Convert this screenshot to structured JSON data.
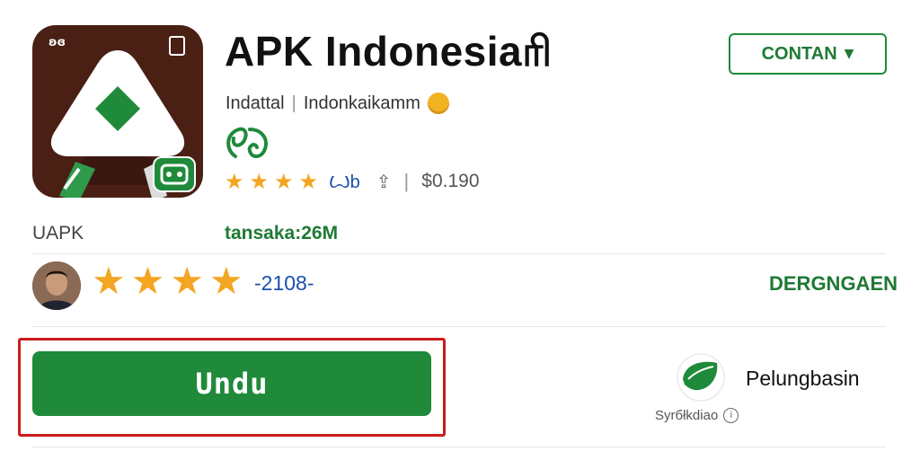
{
  "app": {
    "title": "APK Indonesiaரி",
    "developer": "Indattal",
    "category": "Indonkaikamm",
    "rating_label": "Ꙍb",
    "installs": "$0.190",
    "icon_marks": {
      "top_left": "ʚɞ"
    }
  },
  "header": {
    "content_button_label": "CONTAN"
  },
  "details": {
    "apk_label": "UAPK",
    "size_text": "tansaka:26M"
  },
  "review": {
    "stars": 4,
    "count_text": "-2108-",
    "deregister_label": "DERGNGAEN"
  },
  "actions": {
    "download_label": "Undu"
  },
  "partner": {
    "name": "Pelungbasin",
    "caption": "Syrбłkdiao",
    "info_glyph": "i"
  },
  "colors": {
    "accent_green": "#1f8a3a",
    "highlight_red": "#cc1b1b",
    "star_orange": "#f4a521",
    "link_blue": "#1a4fb0",
    "icon_brown": "#4a1f14"
  }
}
